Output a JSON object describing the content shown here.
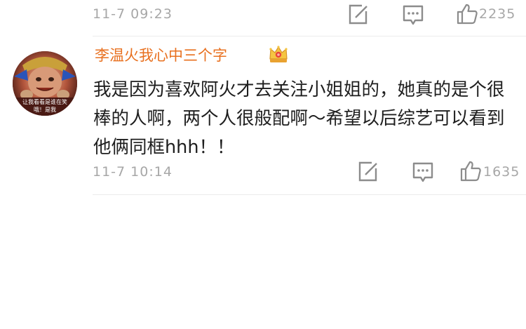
{
  "prev_comment": {
    "timestamp": "11-7 09:23",
    "likes": "2235"
  },
  "comment": {
    "username": "李温火我心中三个字",
    "badge_icon": "crown-icon",
    "avatar_caption_line1": "让我看看是谁在笑",
    "avatar_caption_line2": "哦！是我",
    "text": "我是因为喜欢阿火才去关注小姐姐的，她真的是个很棒的人啊，两个人很般配啊～希望以后综艺可以看到他俩同框hhh！！",
    "timestamp": "11-7 10:14",
    "likes": "1635"
  },
  "icons": {
    "share": "share-icon",
    "reply": "comment-icon",
    "like": "thumbs-up-icon"
  },
  "colors": {
    "username": "#e8701f",
    "meta_text": "#a7a7a7",
    "icon_stroke": "#8c8c8c",
    "divider": "#ececec"
  }
}
